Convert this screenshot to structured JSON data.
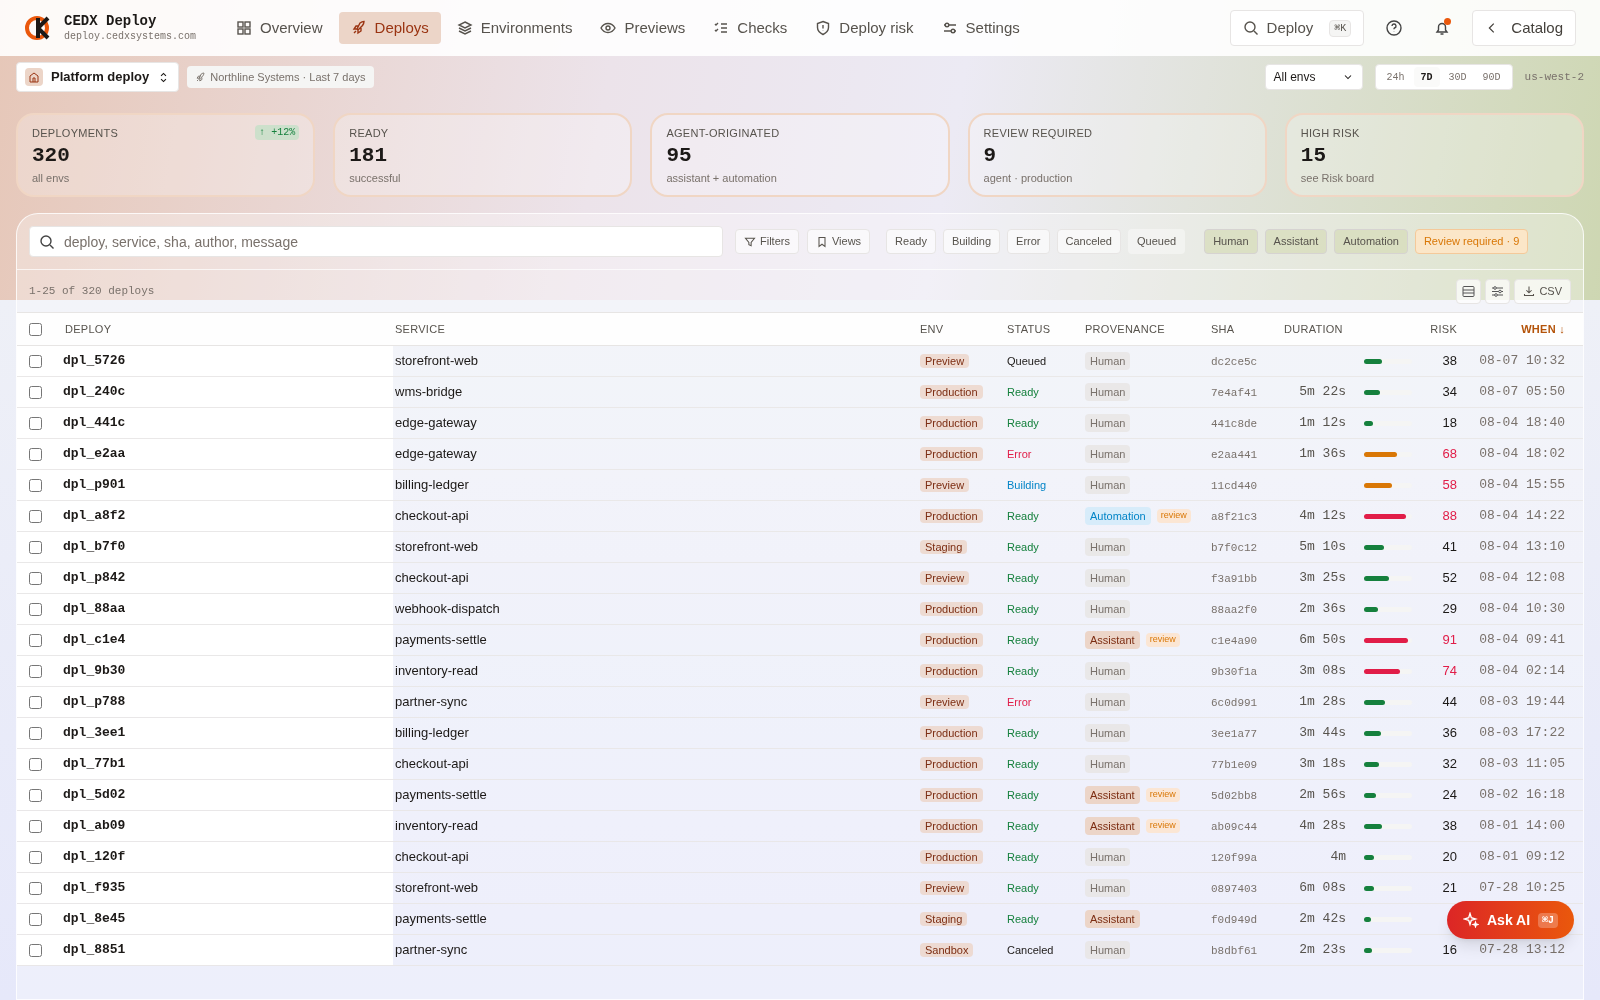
{
  "app": {
    "name": "CEDX Deploy",
    "domain": "deploy.cedxsystems.com"
  },
  "nav": [
    {
      "label": "Overview",
      "selected": false
    },
    {
      "label": "Deploys",
      "selected": true
    },
    {
      "label": "Environments",
      "selected": false
    },
    {
      "label": "Previews",
      "selected": false
    },
    {
      "label": "Checks",
      "selected": false
    },
    {
      "label": "Deploy risk",
      "selected": false
    },
    {
      "label": "Settings",
      "selected": false
    }
  ],
  "search_button": {
    "label": "Deploy",
    "shortcut": "⌘K"
  },
  "notifications": {
    "unread": true
  },
  "catalog_button": {
    "label": "Catalog"
  },
  "project": {
    "name": "Platform deploy",
    "context": "Northline Systems · Last 7 days"
  },
  "env_select": {
    "value": "All envs"
  },
  "ranges": [
    {
      "label": "24h",
      "selected": false
    },
    {
      "label": "7D",
      "selected": true
    },
    {
      "label": "30D",
      "selected": false
    },
    {
      "label": "90D",
      "selected": false
    }
  ],
  "region": "us-west-2",
  "stats": [
    {
      "label": "DEPLOYMENTS",
      "value": "320",
      "sub": "all envs",
      "delta": "↑ +12%"
    },
    {
      "label": "READY",
      "value": "181",
      "sub": "successful"
    },
    {
      "label": "AGENT-ORIGINATED",
      "value": "95",
      "sub": "assistant + automation"
    },
    {
      "label": "REVIEW REQUIRED",
      "value": "9",
      "sub": "agent · production"
    },
    {
      "label": "HIGH RISK",
      "value": "15",
      "sub": "see Risk board"
    }
  ],
  "search": {
    "placeholder": "deploy, service, sha, author, message"
  },
  "filter_buttons": [
    "Filters",
    "Views"
  ],
  "chips": [
    {
      "label": "Ready",
      "kind": "status"
    },
    {
      "label": "Building",
      "kind": "status"
    },
    {
      "label": "Error",
      "kind": "status"
    },
    {
      "label": "Canceled",
      "kind": "status"
    },
    {
      "label": "Queued",
      "kind": "plain"
    },
    {
      "label": "Human",
      "kind": "provenance"
    },
    {
      "label": "Assistant",
      "kind": "provenance"
    },
    {
      "label": "Automation",
      "kind": "provenance"
    },
    {
      "label": "Review required · 9",
      "kind": "review"
    }
  ],
  "count": "1-25 of 320 deploys",
  "csv_button": "CSV",
  "table": {
    "select_all": false,
    "columns": [
      "DEPLOY",
      "SERVICE",
      "ENV",
      "STATUS",
      "PROVENANCE",
      "SHA",
      "DURATION",
      "RISK",
      "WHEN ↓"
    ],
    "rows": [
      {
        "checked": false,
        "id": "dpl_5726",
        "service": "storefront-web",
        "env": "Preview",
        "status": {
          "label": "Queued",
          "kind": "queued"
        },
        "provenance": {
          "label": "Human",
          "kind": "human"
        },
        "sha": "dc2ce5c",
        "level": 0.38,
        "risk": "38",
        "when": "08-07 10:32"
      },
      {
        "checked": false,
        "id": "dpl_240c",
        "service": "wms-bridge",
        "env": "Production",
        "status": {
          "label": "Ready",
          "kind": "ready"
        },
        "provenance": {
          "label": "Human",
          "kind": "human"
        },
        "sha": "7e4af41",
        "duration": "5m 22s",
        "level": 0.34,
        "risk": "34",
        "when": "08-07 05:50"
      },
      {
        "checked": false,
        "id": "dpl_441c",
        "service": "edge-gateway",
        "env": "Production",
        "status": {
          "label": "Ready",
          "kind": "ready"
        },
        "provenance": {
          "label": "Human",
          "kind": "human"
        },
        "sha": "441c8de",
        "duration": "1m 12s",
        "level": 0.18,
        "risk": "18",
        "when": "08-04 18:40"
      },
      {
        "checked": false,
        "id": "dpl_e2aa",
        "service": "edge-gateway",
        "env": "Production",
        "status": {
          "label": "Error",
          "kind": "error"
        },
        "provenance": {
          "label": "Human",
          "kind": "human"
        },
        "sha": "e2aa441",
        "duration": "1m 36s",
        "level": 0.68,
        "risk": "68",
        "when": "08-04 18:02"
      },
      {
        "checked": false,
        "id": "dpl_p901",
        "service": "billing-ledger",
        "env": "Preview",
        "status": {
          "label": "Building",
          "kind": "building"
        },
        "provenance": {
          "label": "Human",
          "kind": "human"
        },
        "sha": "11cd440",
        "level": 0.58,
        "risk": "58",
        "when": "08-04 15:55"
      },
      {
        "checked": false,
        "id": "dpl_a8f2",
        "service": "checkout-api",
        "env": "Production",
        "status": {
          "label": "Ready",
          "kind": "ready"
        },
        "provenance": {
          "label": "Automation",
          "kind": "automation"
        },
        "review": "review",
        "sha": "a8f21c3",
        "duration": "4m 12s",
        "level": 0.88,
        "risk": "88",
        "when": "08-04 14:22"
      },
      {
        "checked": false,
        "id": "dpl_b7f0",
        "service": "storefront-web",
        "env": "Staging",
        "status": {
          "label": "Ready",
          "kind": "ready"
        },
        "provenance": {
          "label": "Human",
          "kind": "human"
        },
        "sha": "b7f0c12",
        "duration": "5m 10s",
        "level": 0.41,
        "risk": "41",
        "when": "08-04 13:10"
      },
      {
        "checked": false,
        "id": "dpl_p842",
        "service": "checkout-api",
        "env": "Preview",
        "status": {
          "label": "Ready",
          "kind": "ready"
        },
        "provenance": {
          "label": "Human",
          "kind": "human"
        },
        "sha": "f3a91bb",
        "duration": "3m 25s",
        "level": 0.52,
        "risk": "52",
        "when": "08-04 12:08"
      },
      {
        "checked": false,
        "id": "dpl_88aa",
        "service": "webhook-dispatch",
        "env": "Production",
        "status": {
          "label": "Ready",
          "kind": "ready"
        },
        "provenance": {
          "label": "Human",
          "kind": "human"
        },
        "sha": "88aa2f0",
        "duration": "2m 36s",
        "level": 0.29,
        "risk": "29",
        "when": "08-04 10:30"
      },
      {
        "checked": false,
        "id": "dpl_c1e4",
        "service": "payments-settle",
        "env": "Production",
        "status": {
          "label": "Ready",
          "kind": "ready"
        },
        "provenance": {
          "label": "Assistant",
          "kind": "assistant"
        },
        "review": "review",
        "sha": "c1e4a90",
        "duration": "6m 50s",
        "level": 0.91,
        "risk": "91",
        "when": "08-04 09:41"
      },
      {
        "checked": false,
        "id": "dpl_9b30",
        "service": "inventory-read",
        "env": "Production",
        "status": {
          "label": "Ready",
          "kind": "ready"
        },
        "provenance": {
          "label": "Human",
          "kind": "human"
        },
        "sha": "9b30f1a",
        "duration": "3m 08s",
        "level": 0.74,
        "risk": "74",
        "when": "08-04 02:14"
      },
      {
        "checked": false,
        "id": "dpl_p788",
        "service": "partner-sync",
        "env": "Preview",
        "status": {
          "label": "Error",
          "kind": "error"
        },
        "provenance": {
          "label": "Human",
          "kind": "human"
        },
        "sha": "6c0d991",
        "duration": "1m 28s",
        "level": 0.44,
        "risk": "44",
        "when": "08-03 19:44"
      },
      {
        "checked": false,
        "id": "dpl_3ee1",
        "service": "billing-ledger",
        "env": "Production",
        "status": {
          "label": "Ready",
          "kind": "ready"
        },
        "provenance": {
          "label": "Human",
          "kind": "human"
        },
        "sha": "3ee1a77",
        "duration": "3m 44s",
        "level": 0.36,
        "risk": "36",
        "when": "08-03 17:22"
      },
      {
        "checked": false,
        "id": "dpl_77b1",
        "service": "checkout-api",
        "env": "Production",
        "status": {
          "label": "Ready",
          "kind": "ready"
        },
        "provenance": {
          "label": "Human",
          "kind": "human"
        },
        "sha": "77b1e09",
        "duration": "3m 18s",
        "level": 0.32,
        "risk": "32",
        "when": "08-03 11:05"
      },
      {
        "checked": false,
        "id": "dpl_5d02",
        "service": "payments-settle",
        "env": "Production",
        "status": {
          "label": "Ready",
          "kind": "ready"
        },
        "provenance": {
          "label": "Assistant",
          "kind": "assistant"
        },
        "review": "review",
        "sha": "5d02bb8",
        "duration": "2m 56s",
        "level": 0.24,
        "risk": "24",
        "when": "08-02 16:18"
      },
      {
        "checked": false,
        "id": "dpl_ab09",
        "service": "inventory-read",
        "env": "Production",
        "status": {
          "label": "Ready",
          "kind": "ready"
        },
        "provenance": {
          "label": "Assistant",
          "kind": "assistant"
        },
        "review": "review",
        "sha": "ab09c44",
        "duration": "4m 28s",
        "level": 0.38,
        "risk": "38",
        "when": "08-01 14:00"
      },
      {
        "checked": false,
        "id": "dpl_120f",
        "service": "checkout-api",
        "env": "Production",
        "status": {
          "label": "Ready",
          "kind": "ready"
        },
        "provenance": {
          "label": "Human",
          "kind": "human"
        },
        "sha": "120f99a",
        "duration": "4m",
        "level": 0.2,
        "risk": "20",
        "when": "08-01 09:12"
      },
      {
        "checked": false,
        "id": "dpl_f935",
        "service": "storefront-web",
        "env": "Preview",
        "status": {
          "label": "Ready",
          "kind": "ready"
        },
        "provenance": {
          "label": "Human",
          "kind": "human"
        },
        "sha": "0897403",
        "duration": "6m 08s",
        "level": 0.21,
        "risk": "21",
        "when": "07-28 10:25"
      },
      {
        "checked": false,
        "id": "dpl_8e45",
        "service": "payments-settle",
        "env": "Staging",
        "status": {
          "label": "Ready",
          "kind": "ready"
        },
        "provenance": {
          "label": "Assistant",
          "kind": "assistant"
        },
        "sha": "f0d949d",
        "duration": "2m 42s",
        "level": 0.15
      },
      {
        "checked": false,
        "id": "dpl_8851",
        "service": "partner-sync",
        "env": "Sandbox",
        "status": {
          "label": "Canceled",
          "kind": "canceled"
        },
        "provenance": {
          "label": "Human",
          "kind": "human"
        },
        "sha": "b8dbf61",
        "duration": "2m 23s",
        "level": 0.16,
        "risk": "16",
        "when": "07-28 13:12"
      }
    ]
  },
  "ask_ai": {
    "label": "Ask AI",
    "shortcut": "⌘J"
  }
}
